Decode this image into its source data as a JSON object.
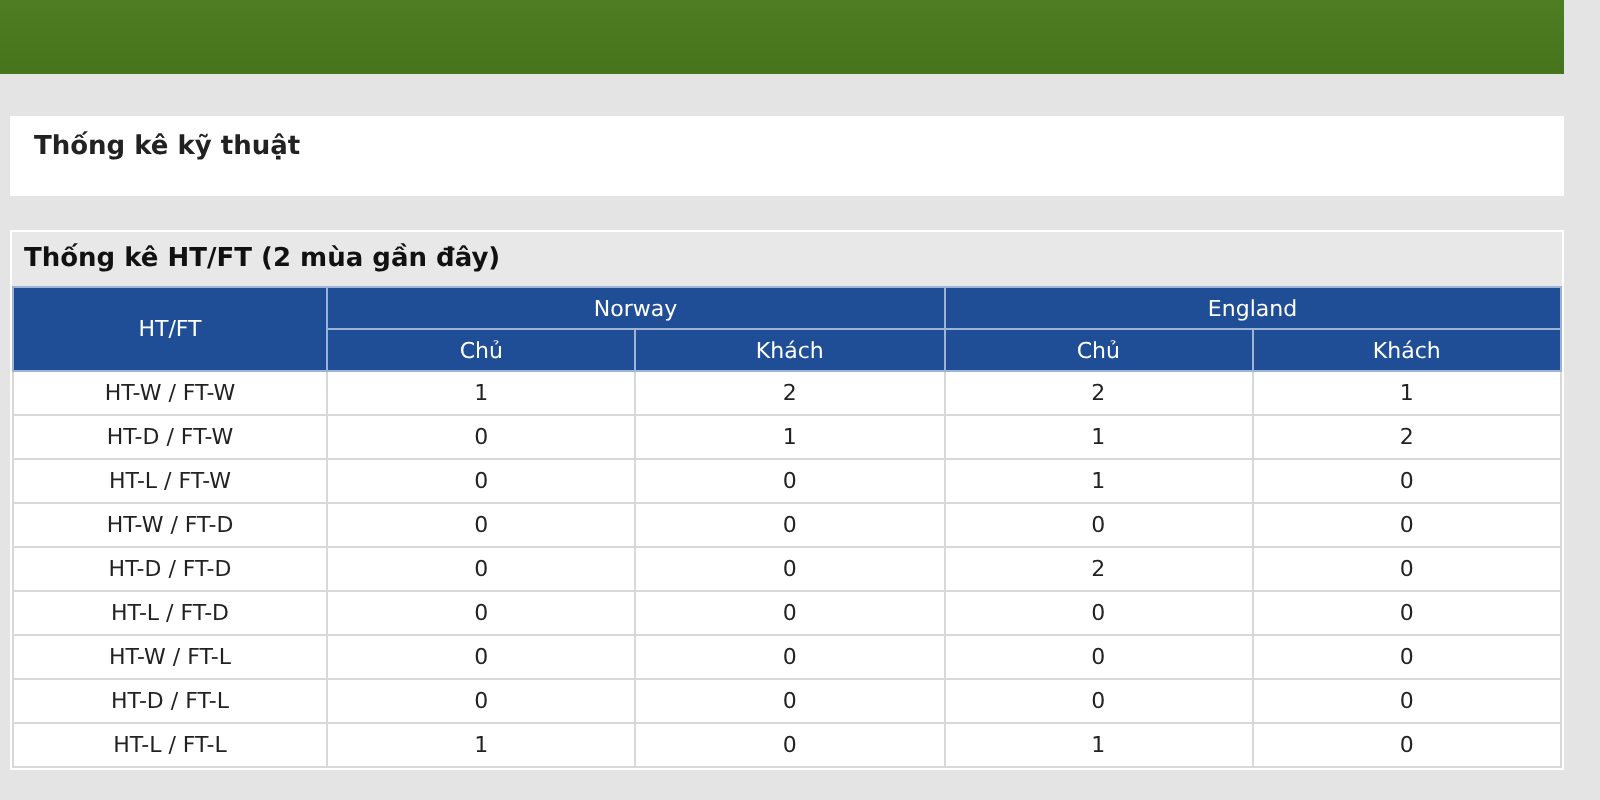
{
  "panel": {
    "title": "Thống kê kỹ thuật"
  },
  "section": {
    "title": "Thống kê HT/FT (2 mùa gần đây)"
  },
  "table": {
    "first_column": "HT/FT",
    "teams": [
      {
        "name": "Norway",
        "sub": [
          "Chủ",
          "Khách"
        ]
      },
      {
        "name": "England",
        "sub": [
          "Chủ",
          "Khách"
        ]
      }
    ],
    "rows": [
      {
        "label": "HT-W / FT-W",
        "values": [
          "1",
          "2",
          "2",
          "1"
        ]
      },
      {
        "label": "HT-D / FT-W",
        "values": [
          "0",
          "1",
          "1",
          "2"
        ]
      },
      {
        "label": "HT-L / FT-W",
        "values": [
          "0",
          "0",
          "1",
          "0"
        ]
      },
      {
        "label": "HT-W / FT-D",
        "values": [
          "0",
          "0",
          "0",
          "0"
        ]
      },
      {
        "label": "HT-D / FT-D",
        "values": [
          "0",
          "0",
          "2",
          "0"
        ]
      },
      {
        "label": "HT-L / FT-D",
        "values": [
          "0",
          "0",
          "0",
          "0"
        ]
      },
      {
        "label": "HT-W / FT-L",
        "values": [
          "0",
          "0",
          "0",
          "0"
        ]
      },
      {
        "label": "HT-D / FT-L",
        "values": [
          "0",
          "0",
          "0",
          "0"
        ]
      },
      {
        "label": "HT-L / FT-L",
        "values": [
          "1",
          "0",
          "1",
          "0"
        ]
      }
    ]
  }
}
